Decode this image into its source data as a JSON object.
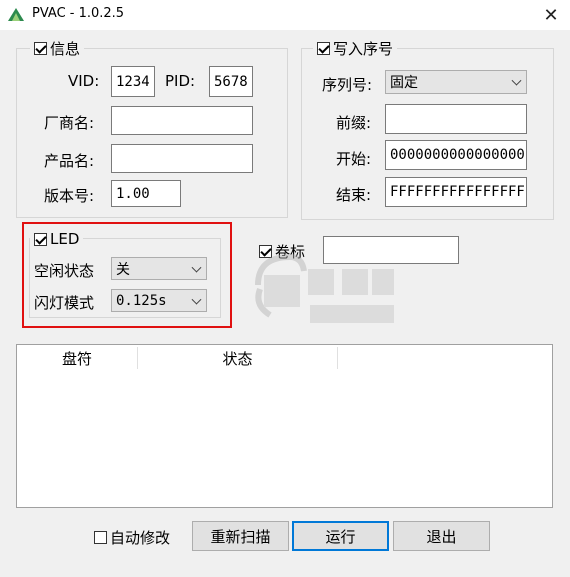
{
  "window": {
    "title": "PVAC - 1.0.2.5",
    "close_glyph": "✕"
  },
  "info": {
    "legend": "信息",
    "checked": true,
    "vid_label": "VID:",
    "vid_value": "1234",
    "pid_label": "PID:",
    "pid_value": "5678",
    "vendor_label": "厂商名:",
    "vendor_value": "",
    "product_label": "产品名:",
    "product_value": "",
    "version_label": "版本号:",
    "version_value": "1.00"
  },
  "serial": {
    "legend": "写入序号",
    "checked": true,
    "serial_label": "序列号:",
    "serial_selected": "固定",
    "prefix_label": "前缀:",
    "prefix_value": "",
    "start_label": "开始:",
    "start_value": "0000000000000000",
    "end_label": "结束:",
    "end_value": "FFFFFFFFFFFFFFFF"
  },
  "led": {
    "legend": "LED",
    "checked": true,
    "idle_label": "空闲状态",
    "idle_selected": "关",
    "blink_label": "闪灯模式",
    "blink_selected": "0.125s"
  },
  "volume": {
    "label": "卷标",
    "checked": true,
    "value": ""
  },
  "list": {
    "columns": [
      "盘符",
      "状态"
    ]
  },
  "footer": {
    "auto_modify_label": "自动修改",
    "auto_modify_checked": false,
    "rescan_label": "重新扫描",
    "run_label": "运行",
    "exit_label": "退出"
  },
  "colors": {
    "highlight": "#e01010",
    "default_button_border": "#0078d7"
  }
}
